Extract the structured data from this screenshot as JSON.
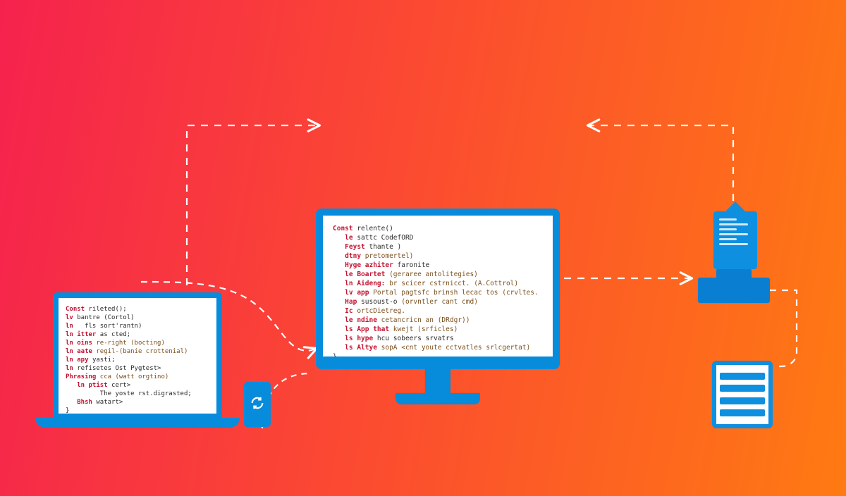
{
  "colors": {
    "gradient_from": "#f5224e",
    "gradient_to": "#ff7a12",
    "device_blue": "#078bdb",
    "doc_blue": "#0f8fe0"
  },
  "laptop_code": [
    {
      "k": "Const ",
      "b": "rileted();"
    },
    {
      "k": "lv ",
      "b": "bantre (Cortol)"
    },
    {
      "k": "ln   ",
      "b": "fls sort'rantn)"
    },
    {
      "k": "ln itter ",
      "b": "as cted;"
    },
    {
      "k": "ln oins ",
      "b": "",
      "n": "re-right (bocting)"
    },
    {
      "k": "ln aate ",
      "b": "",
      "n": "regil-(banie crottenial)"
    },
    {
      "k": "ln apy ",
      "b": "yasti;"
    },
    {
      "k": "ln ",
      "b": "refisetes Ost Pygtest>"
    },
    {
      "k": "Phrasing ",
      "b": "",
      "n": "cca (watt orgtino)"
    },
    {
      "k": "   ln ptist ",
      "b": "cert>"
    },
    {
      "k": "",
      "b": "         The yoste rst.digrasted;"
    },
    {
      "k": "   Bhsh ",
      "b": "watart>"
    },
    {
      "k": "",
      "b": "}"
    }
  ],
  "monitor_code": [
    {
      "k": "Const ",
      "b": "relente()"
    },
    {
      "k": "   le ",
      "b": "sattc CodefORD"
    },
    {
      "k": "   Feyst ",
      "b": "thante )"
    },
    {
      "k": "   dtny ",
      "b": "",
      "n": "pretomertel)"
    },
    {
      "k": "   Hyge azhiter ",
      "b": "faronite"
    },
    {
      "k": "   le Boartet ",
      "b": "",
      "n": "(geraree antolitegies)"
    },
    {
      "k": "   ln Aideng:",
      "b": "",
      "n": " br scicer cstrnicct. (A.Cottrol)"
    },
    {
      "k": "   lv app ",
      "b": "",
      "n": "Portal pagtsfc brinsh lecac tos (crvltes."
    },
    {
      "k": "   Hap ",
      "b": "susoust-o ",
      "n": "(orvntler cant cmd)"
    },
    {
      "k": "   Ic ",
      "b": "",
      "n": "ortcDietreg."
    },
    {
      "k": "   le ndine ",
      "b": "",
      "n": "cetancricn an (DRdgr))"
    },
    {
      "k": "   ls App that ",
      "b": "",
      "n": "kwejt (srficles)"
    },
    {
      "k": "   ls hype ",
      "b": "hcu sobeers srvatrs"
    },
    {
      "k": "   ls Altye ",
      "b": "",
      "n": "sopA <cnt youte cctvatles srlcgertat)"
    },
    {
      "k": "",
      "b": "}"
    }
  ],
  "icons": {
    "sync": "sync-icon",
    "doc": "document-icon",
    "block": "server-block-icon",
    "card": "stacked-card-icon"
  }
}
